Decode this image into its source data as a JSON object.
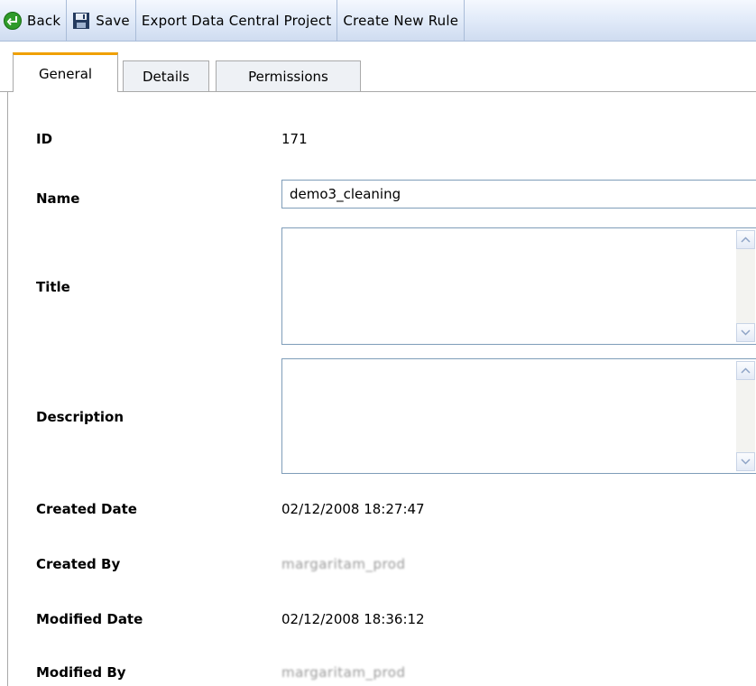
{
  "toolbar": {
    "back_label": "Back",
    "save_label": "Save",
    "export_label": "Export Data Central Project",
    "create_rule_label": "Create New Rule"
  },
  "tabs": {
    "general": "General",
    "details": "Details",
    "permissions": "Permissions"
  },
  "form": {
    "id_label": "ID",
    "id_value": "171",
    "name_label": "Name",
    "name_value": "demo3_cleaning",
    "title_label": "Title",
    "title_value": "",
    "description_label": "Description",
    "description_value": "",
    "created_date_label": "Created Date",
    "created_date_value": "02/12/2008 18:27:47",
    "created_by_label": "Created By",
    "created_by_value": "margaritam_prod",
    "modified_date_label": "Modified Date",
    "modified_date_value": "02/12/2008 18:36:12",
    "modified_by_label": "Modified By",
    "modified_by_value": "margaritam_prod"
  },
  "icons": {
    "back": "back-arrow-icon",
    "save": "floppy-disk-icon"
  },
  "colors": {
    "tab_active_accent": "#f0a000",
    "toolbar_bg": "#dfe9f8",
    "back_icon": "#2f9b2a"
  }
}
